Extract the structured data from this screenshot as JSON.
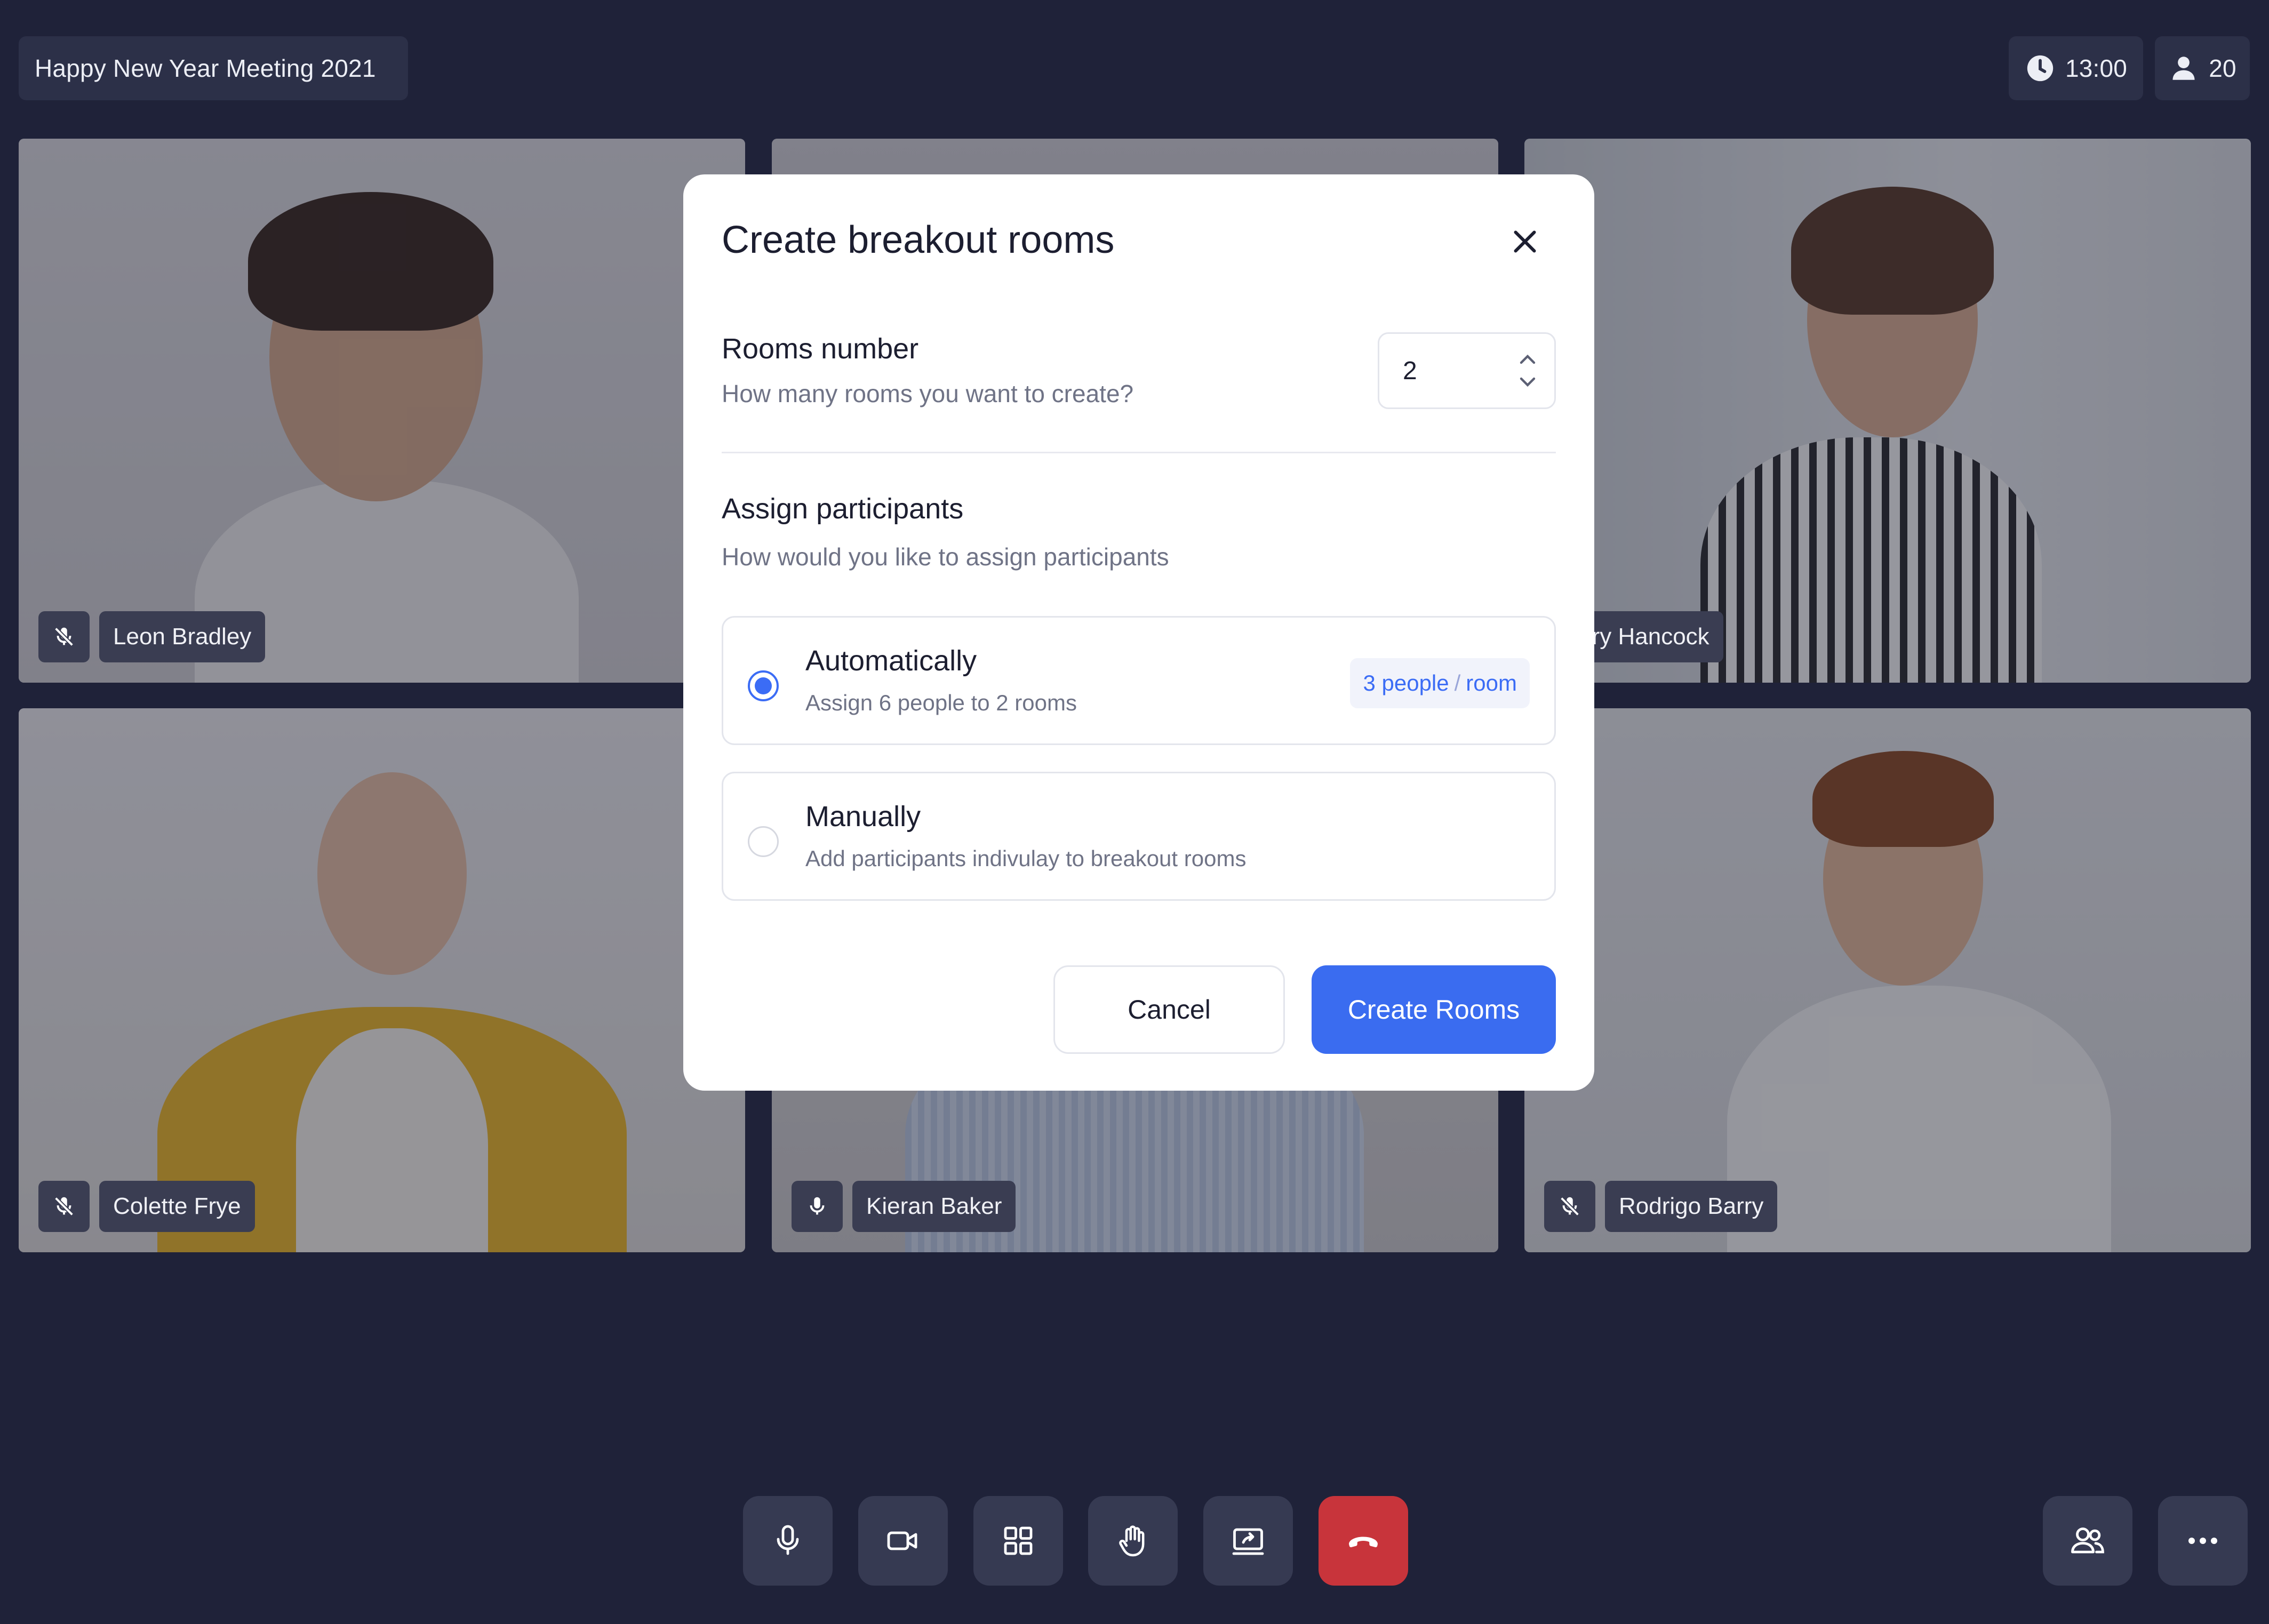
{
  "meeting": {
    "title": "Happy New Year Meeting 2021",
    "time": "13:00",
    "participant_count": "20"
  },
  "participants": [
    {
      "name": "Leon Bradley",
      "muted": true
    },
    {
      "name": "Larry Hancock",
      "muted": null
    },
    {
      "name": "Colette Frye",
      "muted": true
    },
    {
      "name": "Kieran Baker",
      "muted": false
    },
    {
      "name": "Rodrigo Barry",
      "muted": true
    }
  ],
  "dialog": {
    "title": "Create breakout rooms",
    "rooms": {
      "label": "Rooms number",
      "hint": "How many rooms you want to create?",
      "value": "2"
    },
    "assign": {
      "label": "Assign participants",
      "hint": "How would you like to assign participants",
      "options": [
        {
          "title": "Automatically",
          "description": "Assign 6 people to 2 rooms",
          "badge_people": "3 people",
          "badge_sep": "/",
          "badge_unit": "room",
          "selected": true
        },
        {
          "title": "Manually",
          "description": "Add participants indivulay to breakout rooms",
          "selected": false
        }
      ]
    },
    "cancel_label": "Cancel",
    "create_label": "Create Rooms"
  },
  "controls": [
    "microphone-icon",
    "camera-icon",
    "grid-layout-icon",
    "raise-hand-icon",
    "share-screen-icon",
    "hang-up-icon",
    "participants-icon",
    "more-icon"
  ],
  "colors": {
    "background": "#1f2239",
    "accent": "#3a6cf0",
    "hangup": "#c8343b"
  }
}
